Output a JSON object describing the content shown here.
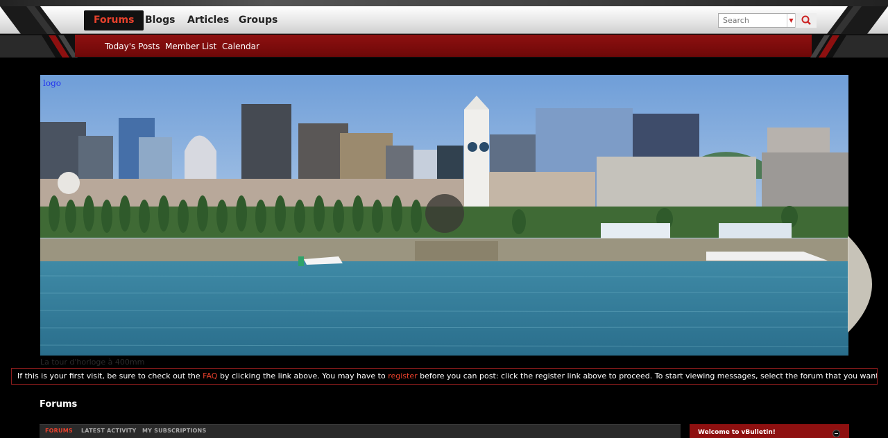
{
  "nav": {
    "tabs": [
      {
        "label": "Forums",
        "active": true
      },
      {
        "label": "Blogs",
        "active": false
      },
      {
        "label": "Articles",
        "active": false
      },
      {
        "label": "Groups",
        "active": false
      }
    ],
    "search": {
      "placeholder": "Search",
      "caret_icon": "chevron-down-icon",
      "button_icon": "search-icon"
    }
  },
  "subnav": {
    "links": [
      "Today's Posts",
      "Member List",
      "Calendar"
    ]
  },
  "banner": {
    "logo_text": "logo",
    "caption": "La tour d'horloge à 400mm"
  },
  "notice": {
    "part1": "If this is your first visit, be sure to check out the ",
    "faq": "FAQ",
    "part2": " by clicking the link above. You may have to ",
    "register": "register",
    "part3": " before you can post: click the register link above to proceed. To start viewing messages, select the forum that you want to visit from the selection below."
  },
  "main": {
    "title": "Forums",
    "tabs": [
      {
        "label": "FORUMS",
        "active": true
      },
      {
        "label": "LATEST ACTIVITY",
        "active": false
      },
      {
        "label": "MY SUBSCRIPTIONS",
        "active": false
      }
    ]
  },
  "sidebar": {
    "welcome_title": "Welcome to vBulletin!"
  },
  "colors": {
    "accent": "#e8412c",
    "bar_red": "#8e1010",
    "background": "#000000"
  }
}
